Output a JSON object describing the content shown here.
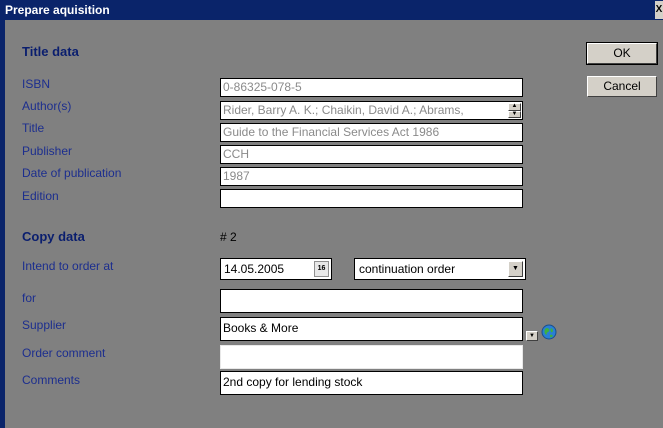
{
  "window": {
    "title": "Prepare aquisition",
    "close_label": "X"
  },
  "buttons": {
    "ok": "OK",
    "cancel": "Cancel"
  },
  "title_section": {
    "heading": "Title data",
    "isbn_label": "ISBN",
    "isbn": "0-86325-078-5",
    "authors_label": "Author(s)",
    "authors": "Rider, Barry A. K.; Chaikin, David A.; Abrams,",
    "title_label": "Title",
    "title": "Guide to the Financial Services Act 1986",
    "publisher_label": "Publisher",
    "publisher": "CCH",
    "date_label": "Date of publication",
    "date": "1987",
    "edition_label": "Edition",
    "edition": ""
  },
  "copy_section": {
    "heading": "Copy data",
    "copy_number": "# 2",
    "intend_label": "Intend to order at",
    "order_date": "14.05.2005",
    "calendar_label": "16",
    "order_type": "continuation order",
    "for_label": "for",
    "for_value": "",
    "supplier_label": "Supplier",
    "supplier": "Books & More",
    "order_comment_label": "Order comment",
    "order_comment": "",
    "comments_label": "Comments",
    "comments": "2nd copy for lending stock"
  }
}
